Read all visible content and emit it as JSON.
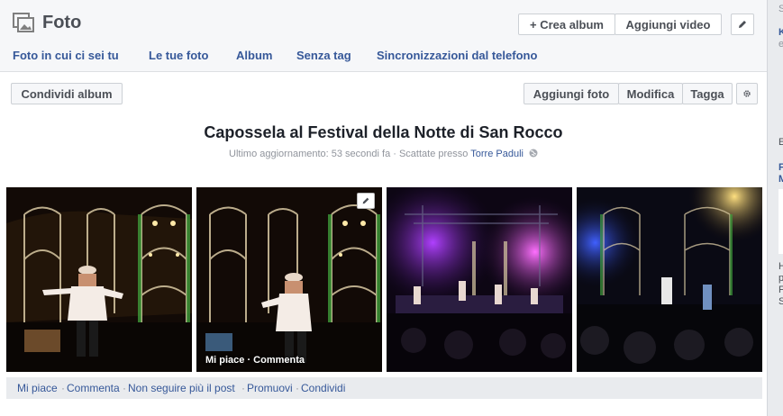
{
  "header": {
    "title": "Foto",
    "crea_album": "+ Crea album",
    "aggiungi_video": "Aggiungi video"
  },
  "tabs": [
    {
      "label": "Foto in cui ci sei tu"
    },
    {
      "label": "Le tue foto"
    },
    {
      "label": "Album"
    },
    {
      "label": "Senza tag"
    },
    {
      "label": "Sincronizzazioni dal telefono"
    }
  ],
  "toolbar": {
    "share_album": "Condividi album",
    "add_photo": "Aggiungi foto",
    "edit": "Modifica",
    "tag": "Tagga"
  },
  "album": {
    "title": "Capossela al Festival della Notte di San Rocco",
    "updated": "Ultimo aggiornamento: 53 secondi fa · Scattate presso ",
    "location": "Torre Paduli"
  },
  "photos": {
    "hover_actions": "Mi piace · Commenta"
  },
  "footer": {
    "like": "Mi piace",
    "comment": "Commenta",
    "unfollow": "Non seguire più il post",
    "promote": "Promuovi",
    "share": "Condividi",
    "sep": "·"
  },
  "right_column": {
    "f1": "S",
    "f2": "K",
    "f3": "e",
    "f4": "E",
    "f5": "F",
    "f6": "M",
    "f7": "H",
    "f8": "p",
    "f9": "F",
    "f10": "S"
  },
  "colors": {
    "link": "#365899",
    "header_bg": "#f6f7f9",
    "text_dark": "#1d2129"
  }
}
